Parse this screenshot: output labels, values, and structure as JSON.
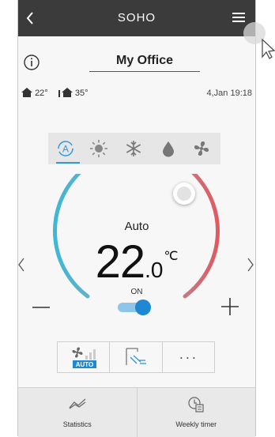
{
  "header": {
    "title": "SOHO",
    "back_icon": "chevron-left-icon",
    "menu_icon": "hamburger-menu-icon"
  },
  "room": {
    "name": "My Office",
    "info_icon": "info-icon"
  },
  "status": {
    "indoor_temp": "22°",
    "outdoor_temp": "35°",
    "datetime": "4,Jan 19:18"
  },
  "modes": {
    "selected": "auto",
    "items": [
      "auto",
      "cool",
      "heat",
      "dry",
      "fan"
    ]
  },
  "dial": {
    "mode_label": "Auto",
    "temp_int": "22",
    "temp_dec": ".0",
    "temp_unit": "℃",
    "power_label": "ON",
    "power_on": true
  },
  "functions": {
    "fan_badge": "AUTO",
    "items": [
      "fan-speed-auto",
      "airflow-direction",
      "more-options"
    ],
    "more_label": "···"
  },
  "bottom_nav": {
    "statistics_label": "Statistics",
    "weekly_timer_label": "Weekly timer"
  },
  "colors": {
    "header_bg": "#3b3b3b",
    "accent": "#2c9ad8",
    "arc_cool": "#3fb7d6",
    "arc_warm": "#e05a60",
    "toggle": "#1e88d2"
  }
}
